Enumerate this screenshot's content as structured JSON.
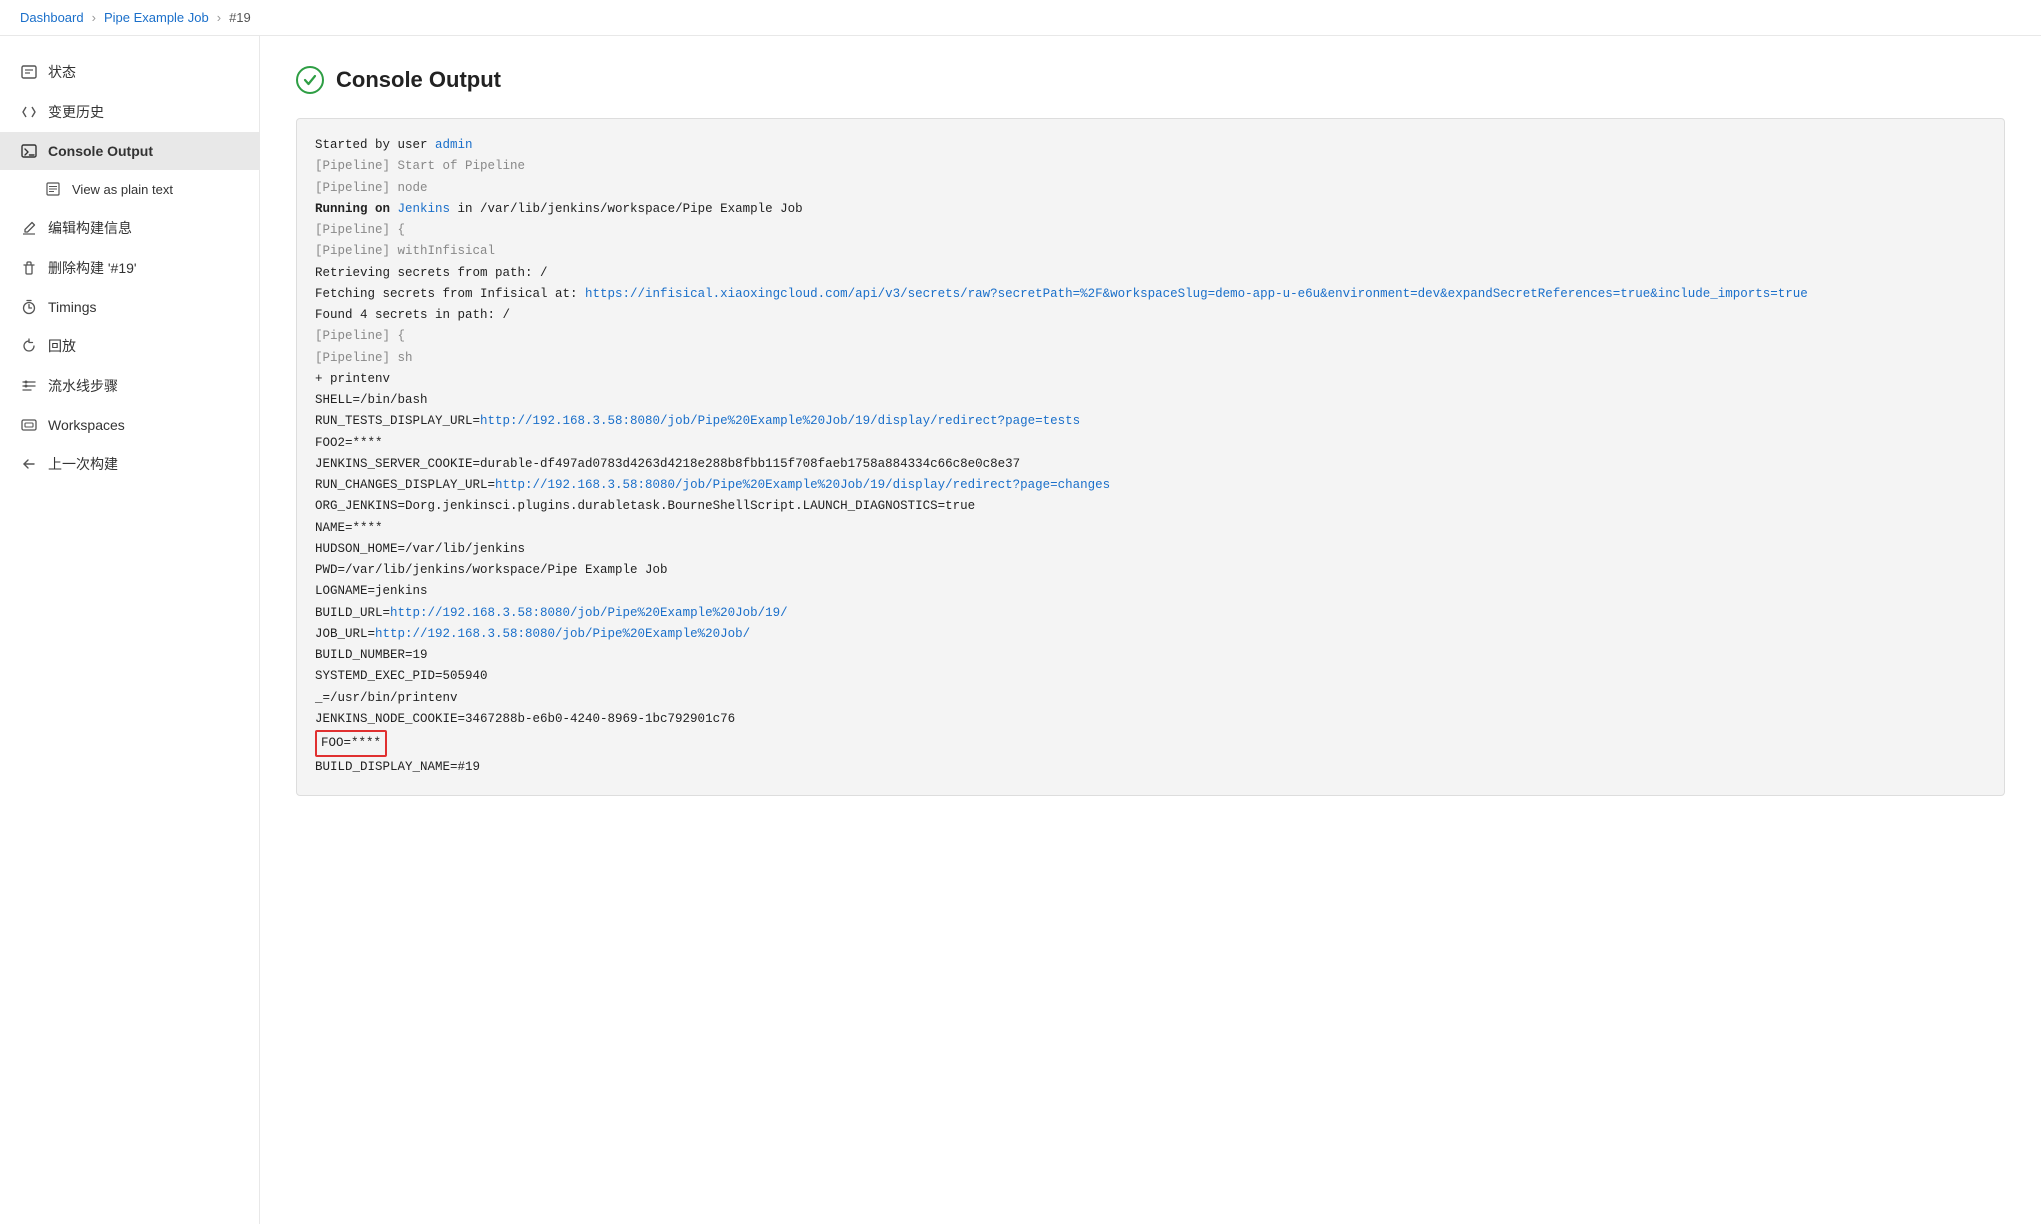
{
  "breadcrumb": {
    "items": [
      "Dashboard",
      "Pipe Example Job",
      "#19"
    ]
  },
  "sidebar": {
    "items": [
      {
        "id": "status",
        "label": "状态",
        "icon": "📋",
        "active": false,
        "sub": false
      },
      {
        "id": "changes",
        "label": "变更历史",
        "icon": "</>",
        "active": false,
        "sub": false
      },
      {
        "id": "console",
        "label": "Console Output",
        "icon": "▶",
        "active": true,
        "sub": false
      },
      {
        "id": "plain",
        "label": "View as plain text",
        "icon": "📄",
        "active": false,
        "sub": true
      },
      {
        "id": "edit",
        "label": "编辑构建信息",
        "icon": "✏",
        "active": false,
        "sub": false
      },
      {
        "id": "delete",
        "label": "删除构建 '#19'",
        "icon": "🗑",
        "active": false,
        "sub": false
      },
      {
        "id": "timings",
        "label": "Timings",
        "icon": "⏱",
        "active": false,
        "sub": false
      },
      {
        "id": "replay",
        "label": "回放",
        "icon": "↻",
        "active": false,
        "sub": false
      },
      {
        "id": "pipeline-steps",
        "label": "流水线步骤",
        "icon": "≡",
        "active": false,
        "sub": false
      },
      {
        "id": "workspaces",
        "label": "Workspaces",
        "icon": "▭",
        "active": false,
        "sub": false
      },
      {
        "id": "prev-build",
        "label": "上一次构建",
        "icon": "←",
        "active": false,
        "sub": false
      }
    ]
  },
  "console": {
    "title": "Console Output",
    "lines": [
      {
        "type": "normal",
        "text": "Started by user "
      },
      {
        "type": "link-inline",
        "prefix": "Started by user ",
        "link_text": "admin",
        "link_url": "#"
      },
      {
        "type": "dim",
        "text": "[Pipeline] Start of Pipeline"
      },
      {
        "type": "dim",
        "text": "[Pipeline] node"
      },
      {
        "type": "bold",
        "text": "Running on "
      },
      {
        "type": "dim",
        "text": "[Pipeline] {"
      },
      {
        "type": "dim",
        "text": "[Pipeline] withInfisical"
      },
      {
        "type": "normal",
        "text": "Retrieving secrets from path: /"
      },
      {
        "type": "normal-link",
        "prefix": "Fetching secrets from Infisical at: ",
        "link_text": "https://infisical.xiaoxingcloud.com/api/v3/secrets/raw?secretPath=%2F&workspaceSlug=demo-app-u-e6u&environment=dev&expandSecretReferences=true&include_imports=true",
        "link_url": "#"
      },
      {
        "type": "normal",
        "text": "Found 4 secrets in path: /"
      },
      {
        "type": "dim",
        "text": "[Pipeline] {"
      },
      {
        "type": "dim",
        "text": "[Pipeline] sh"
      },
      {
        "type": "normal",
        "text": "+ printenv"
      },
      {
        "type": "normal",
        "text": "SHELL=/bin/bash"
      },
      {
        "type": "normal-link",
        "prefix": "RUN_TESTS_DISPLAY_URL=",
        "link_text": "http://192.168.3.58:8080/job/Pipe%20Example%20Job/19/display/redirect?page=tests",
        "link_url": "#"
      },
      {
        "type": "normal",
        "text": "FOO2=****"
      },
      {
        "type": "normal",
        "text": "JENKINS_SERVER_COOKIE=durable-df497ad0783d4263d4218e288b8fbb115f708faeb1758a884334c66c8e0c8e37"
      },
      {
        "type": "normal-link",
        "prefix": "RUN_CHANGES_DISPLAY_URL=",
        "link_text": "http://192.168.3.58:8080/job/Pipe%20Example%20Job/19/display/redirect?page=changes",
        "link_url": "#"
      },
      {
        "type": "normal",
        "text": "ORG_JENKINS=Dorg.jenkinsci.plugins.durabletask.BourneShellScript.LAUNCH_DIAGNOSTICS=true"
      },
      {
        "type": "normal",
        "text": "NAME=****"
      },
      {
        "type": "normal",
        "text": "HUDSON_HOME=/var/lib/jenkins"
      },
      {
        "type": "normal",
        "text": "PWD=/var/lib/jenkins/workspace/Pipe Example Job"
      },
      {
        "type": "normal",
        "text": "LOGNAME=jenkins"
      },
      {
        "type": "normal-link",
        "prefix": "BUILD_URL=",
        "link_text": "http://192.168.3.58:8080/job/Pipe%20Example%20Job/19/",
        "link_url": "#"
      },
      {
        "type": "normal-link",
        "prefix": "JOB_URL=",
        "link_text": "http://192.168.3.58:8080/job/Pipe%20Example%20Job/",
        "link_url": "#"
      },
      {
        "type": "normal",
        "text": "BUILD_NUMBER=19"
      },
      {
        "type": "normal",
        "text": "SYSTEMD_EXEC_PID=505940"
      },
      {
        "type": "normal",
        "text": "_=/usr/bin/printenv"
      },
      {
        "type": "normal",
        "text": "JENKINS_NODE_COOKIE=3467288b-e6b0-4240-8969-1bc792901c76"
      },
      {
        "type": "highlight",
        "text": "FOO=****"
      },
      {
        "type": "normal",
        "text": "BUILD_DISPLAY_NAME=#19"
      }
    ]
  }
}
